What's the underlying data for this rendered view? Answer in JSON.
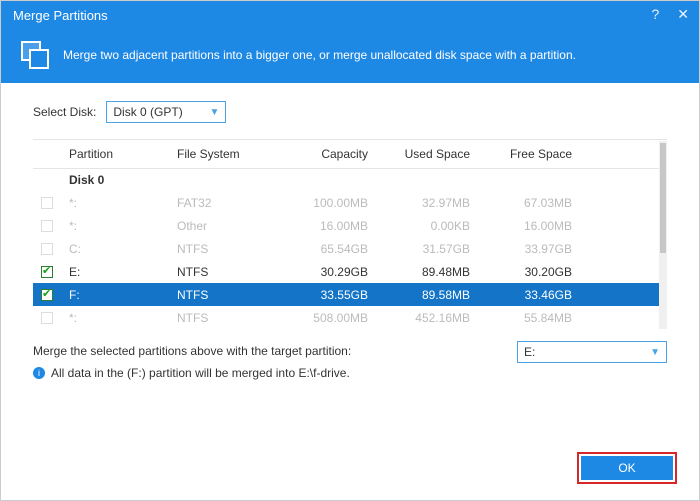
{
  "header": {
    "title": "Merge Partitions",
    "banner": "Merge two adjacent partitions into a bigger one, or merge unallocated disk space with a partition."
  },
  "diskSelector": {
    "label": "Select Disk:",
    "value": "Disk 0 (GPT)"
  },
  "columns": {
    "partition": "Partition",
    "fs": "File System",
    "capacity": "Capacity",
    "used": "Used Space",
    "free": "Free Space"
  },
  "groupLabel": "Disk 0",
  "rows": [
    {
      "checked": false,
      "enabled": false,
      "selected": false,
      "part": "*:",
      "fs": "FAT32",
      "cap": "100.00MB",
      "used": "32.97MB",
      "free": "67.03MB"
    },
    {
      "checked": false,
      "enabled": false,
      "selected": false,
      "part": "*:",
      "fs": "Other",
      "cap": "16.00MB",
      "used": "0.00KB",
      "free": "16.00MB"
    },
    {
      "checked": false,
      "enabled": false,
      "selected": false,
      "part": "C:",
      "fs": "NTFS",
      "cap": "65.54GB",
      "used": "31.57GB",
      "free": "33.97GB"
    },
    {
      "checked": true,
      "enabled": true,
      "selected": false,
      "part": "E:",
      "fs": "NTFS",
      "cap": "30.29GB",
      "used": "89.48MB",
      "free": "30.20GB"
    },
    {
      "checked": true,
      "enabled": true,
      "selected": true,
      "part": "F:",
      "fs": "NTFS",
      "cap": "33.55GB",
      "used": "89.58MB",
      "free": "33.46GB"
    },
    {
      "checked": false,
      "enabled": false,
      "selected": false,
      "part": "*:",
      "fs": "NTFS",
      "cap": "508.00MB",
      "used": "452.16MB",
      "free": "55.84MB"
    }
  ],
  "mergeText": {
    "line1": "Merge the selected partitions above with the target partition:",
    "line2": "All data in the (F:) partition will be merged into E:\\f-drive."
  },
  "targetSelect": {
    "value": "E:"
  },
  "buttons": {
    "ok": "OK"
  }
}
